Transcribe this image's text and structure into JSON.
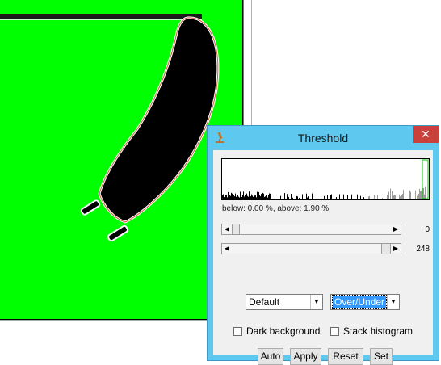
{
  "dialog": {
    "title": "Threshold",
    "close_glyph": "✕",
    "app_icon": "microscope-icon",
    "stats_text": "below: 0.00 %,  above: 1.90 %",
    "min_value": "0",
    "max_value": "248",
    "method_value": "Default",
    "display_value": "Over/Under",
    "dark_background_label": "Dark background",
    "dark_background_checked": false,
    "stack_histogram_label": "Stack histogram",
    "stack_histogram_checked": false,
    "buttons": {
      "auto": "Auto",
      "apply": "Apply",
      "reset": "Reset",
      "set": "Set"
    }
  },
  "colors": {
    "titlebar": "#5fc8ee",
    "close": "#c8413b",
    "overlay": "#00ff00",
    "selection": "#3399ff"
  }
}
